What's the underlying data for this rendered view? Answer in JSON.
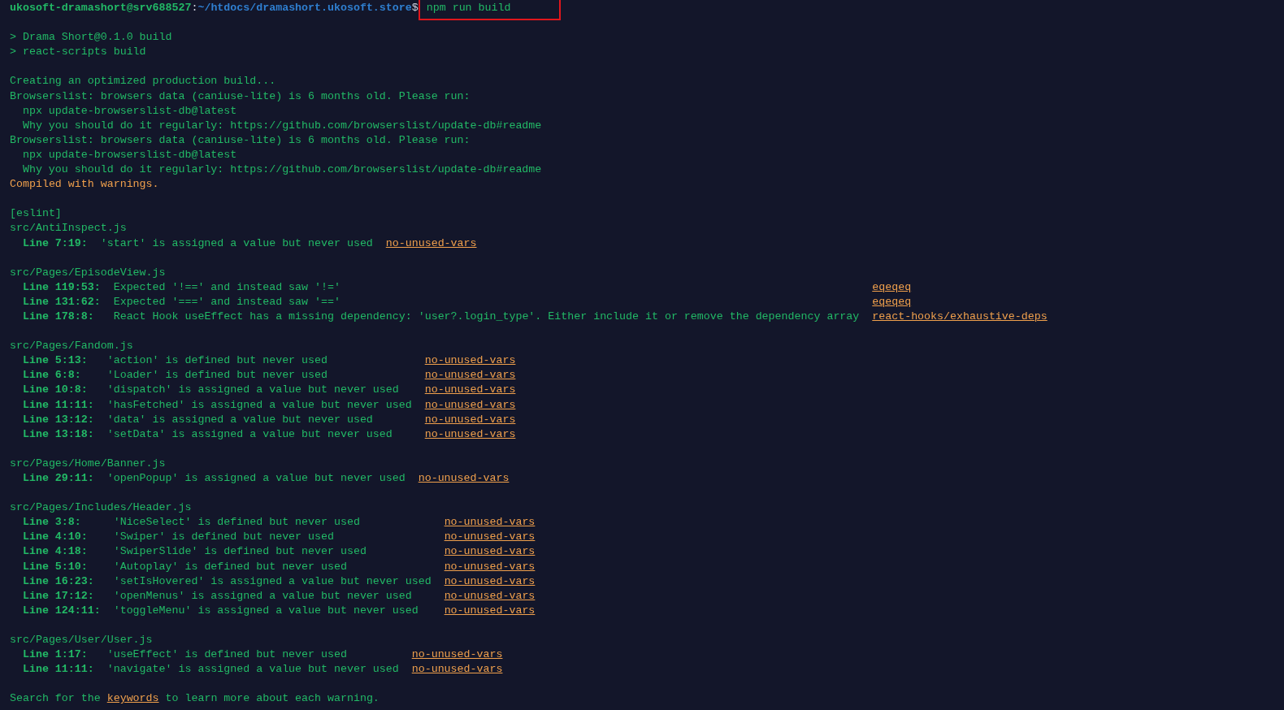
{
  "prompt": {
    "user_host": "ukosoft-dramashort@srv688527",
    "separator": ":",
    "path": "~/htdocs/dramashort.ukosoft.store",
    "symbol": "$",
    "command": "npm run build",
    "highlighted": true
  },
  "blocks": [
    {
      "lines": [
        {
          "kind": "plain",
          "text": "> Drama Short@0.1.0 build"
        },
        {
          "kind": "plain",
          "text": "> react-scripts build"
        }
      ]
    },
    {
      "lines": [
        {
          "kind": "plain",
          "text": "Creating an optimized production build..."
        },
        {
          "kind": "plain",
          "text": "Browserslist: browsers data (caniuse-lite) is 6 months old. Please run:"
        },
        {
          "kind": "indented",
          "text": "npx update-browserslist-db@latest"
        },
        {
          "kind": "indented",
          "text": "Why you should do it regularly: https://github.com/browserslist/update-db#readme"
        },
        {
          "kind": "plain",
          "text": "Browserslist: browsers data (caniuse-lite) is 6 months old. Please run:"
        },
        {
          "kind": "indented",
          "text": "npx update-browserslist-db@latest"
        },
        {
          "kind": "indented",
          "text": "Why you should do it regularly: https://github.com/browserslist/update-db#readme"
        },
        {
          "kind": "notice",
          "text": "Compiled with warnings."
        }
      ]
    },
    {
      "lines": [
        {
          "kind": "plain",
          "text": "[eslint]"
        }
      ],
      "file": "src/AntiInspect.js",
      "warnings": [
        {
          "position": "Line 7:19:",
          "message": "'start' is assigned a value but never used",
          "rule": "no-unused-vars"
        }
      ]
    },
    {
      "file": "src/Pages/EpisodeView.js",
      "warnings": [
        {
          "position": "Line 119:53:",
          "message": "Expected '!==' and instead saw '!='",
          "rule": "eqeqeq"
        },
        {
          "position": "Line 131:62:",
          "message": "Expected '===' and instead saw '=='",
          "rule": "eqeqeq"
        },
        {
          "position": "Line 178:8:",
          "message": "React Hook useEffect has a missing dependency: 'user?.login_type'. Either include it or remove the dependency array",
          "rule": "react-hooks/exhaustive-deps"
        }
      ]
    },
    {
      "file": "src/Pages/Fandom.js",
      "warnings": [
        {
          "position": "Line 5:13:",
          "message": "'action' is defined but never used",
          "rule": "no-unused-vars"
        },
        {
          "position": "Line 6:8:",
          "message": "'Loader' is defined but never used",
          "rule": "no-unused-vars"
        },
        {
          "position": "Line 10:8:",
          "message": "'dispatch' is assigned a value but never used",
          "rule": "no-unused-vars"
        },
        {
          "position": "Line 11:11:",
          "message": "'hasFetched' is assigned a value but never used",
          "rule": "no-unused-vars"
        },
        {
          "position": "Line 13:12:",
          "message": "'data' is assigned a value but never used",
          "rule": "no-unused-vars"
        },
        {
          "position": "Line 13:18:",
          "message": "'setData' is assigned a value but never used",
          "rule": "no-unused-vars"
        }
      ]
    },
    {
      "file": "src/Pages/Home/Banner.js",
      "warnings": [
        {
          "position": "Line 29:11:",
          "message": "'openPopup' is assigned a value but never used",
          "rule": "no-unused-vars"
        }
      ]
    },
    {
      "file": "src/Pages/Includes/Header.js",
      "warnings": [
        {
          "position": "Line 3:8:",
          "message": "'NiceSelect' is defined but never used",
          "rule": "no-unused-vars"
        },
        {
          "position": "Line 4:10:",
          "message": "'Swiper' is defined but never used",
          "rule": "no-unused-vars"
        },
        {
          "position": "Line 4:18:",
          "message": "'SwiperSlide' is defined but never used",
          "rule": "no-unused-vars"
        },
        {
          "position": "Line 5:10:",
          "message": "'Autoplay' is defined but never used",
          "rule": "no-unused-vars"
        },
        {
          "position": "Line 16:23:",
          "message": "'setIsHovered' is assigned a value but never used",
          "rule": "no-unused-vars"
        },
        {
          "position": "Line 17:12:",
          "message": "'openMenus' is assigned a value but never used",
          "rule": "no-unused-vars"
        },
        {
          "position": "Line 124:11:",
          "message": "'toggleMenu' is assigned a value but never used",
          "rule": "no-unused-vars"
        }
      ]
    },
    {
      "file": "src/Pages/User/User.js",
      "warnings": [
        {
          "position": "Line 1:17:",
          "message": "'useEffect' is defined but never used",
          "rule": "no-unused-vars"
        },
        {
          "position": "Line 11:11:",
          "message": "'navigate' is assigned a value but never used",
          "rule": "no-unused-vars"
        }
      ]
    },
    {
      "footer": {
        "before": "Search for the ",
        "link": "keywords",
        "after": " to learn more about each warning."
      }
    }
  ]
}
